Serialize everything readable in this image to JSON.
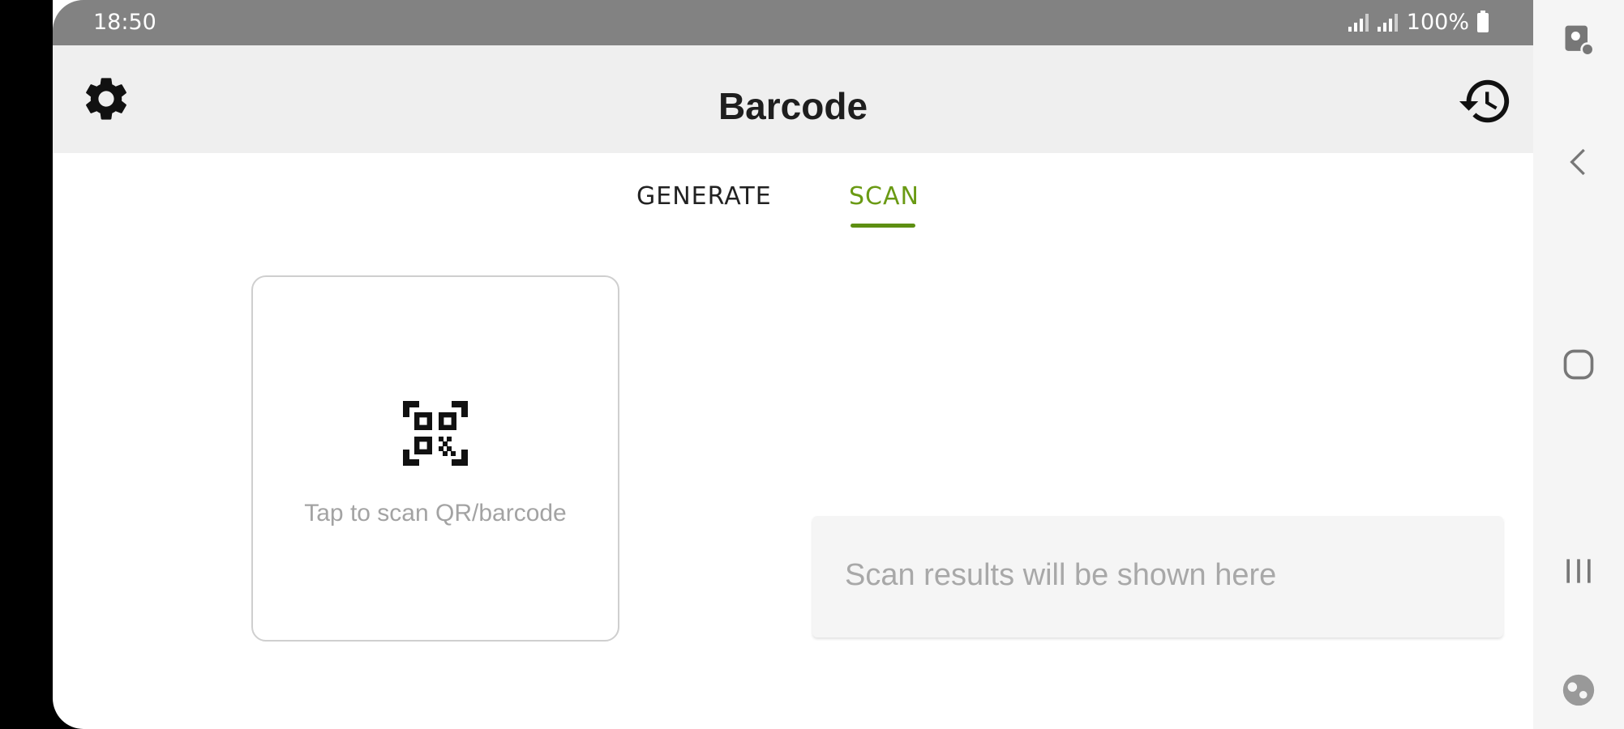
{
  "status_bar": {
    "time": "18:50",
    "battery": "100%"
  },
  "app_bar": {
    "title": "Barcode",
    "settings_icon": "gear-icon",
    "history_icon": "history-icon"
  },
  "tabs": [
    {
      "label": "GENERATE",
      "active": false
    },
    {
      "label": "SCAN",
      "active": true
    }
  ],
  "scan_card": {
    "icon": "qr-scan-icon",
    "label": "Tap to scan QR/barcode"
  },
  "results": {
    "placeholder": "Scan results will be shown here"
  },
  "nav_bar": {
    "icons": [
      "pointer-icon",
      "back-icon",
      "home-icon",
      "recents-icon",
      "assistant-icon"
    ]
  },
  "colors": {
    "accent": "#6a9a14",
    "status_bar": "#828282",
    "app_bar": "#efefef"
  }
}
